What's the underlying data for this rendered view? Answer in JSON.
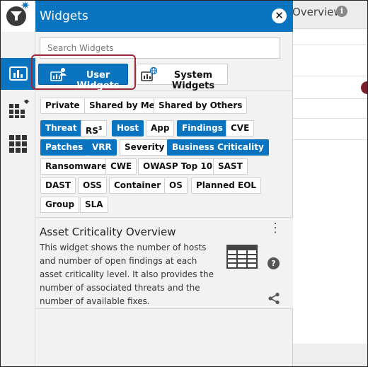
{
  "background": {
    "title_fragment": "Overview",
    "info_icon": "info-icon"
  },
  "rail": {
    "items": [
      {
        "icon": "bar-chart-icon",
        "active": true
      },
      {
        "icon": "grid-add-icon",
        "active": false
      },
      {
        "icon": "grid-icon",
        "active": false
      }
    ]
  },
  "panel": {
    "title": "Widgets",
    "close_icon": "close-icon",
    "search_placeholder": "Search Widgets",
    "buttons": {
      "user": "User Widgets",
      "system": "System Widgets"
    },
    "filter_rows": [
      [
        {
          "label": "Private",
          "selected": false
        },
        {
          "label": "Shared by Me",
          "selected": false
        },
        {
          "label": "Shared by Others",
          "selected": false
        }
      ],
      [
        {
          "label": "Threat",
          "selected": true
        },
        {
          "label": "RS",
          "sup": "3",
          "selected": false
        },
        {
          "label": "Host",
          "selected": true
        },
        {
          "label": "App",
          "selected": false
        },
        {
          "label": "Findings",
          "selected": true
        },
        {
          "label": "CVE",
          "selected": false
        }
      ],
      [
        {
          "label": "Patches",
          "selected": true
        },
        {
          "label": "VRR",
          "selected": true
        },
        {
          "label": "Severity",
          "selected": false
        },
        {
          "label": "Business Criticality",
          "selected": true
        }
      ],
      [
        {
          "label": "Ransomware",
          "selected": false
        },
        {
          "label": "CWE",
          "selected": false
        },
        {
          "label": "OWASP Top 10",
          "selected": false
        },
        {
          "label": "SAST",
          "selected": false
        }
      ],
      [
        {
          "label": "DAST",
          "selected": false
        },
        {
          "label": "OSS",
          "selected": false
        },
        {
          "label": "Container",
          "selected": false
        },
        {
          "label": "OS",
          "selected": false
        },
        {
          "label": "Planned EOL",
          "selected": false
        }
      ],
      [
        {
          "label": "Group",
          "selected": false
        },
        {
          "label": "SLA",
          "selected": false
        }
      ]
    ],
    "widget_card": {
      "title": "Asset Criticality Overview",
      "description": "This widget shows the number of hosts and number of open findings at each asset criticality level. It also provides the number of associated threats and the number of available fixes.",
      "menu_icon": "more-vertical-icon",
      "preview_icon": "table-icon",
      "help_icon": "help-icon",
      "share_icon": "share-icon"
    }
  },
  "colors": {
    "primary": "#0b74c0",
    "highlight": "#9b2836",
    "panel_bg": "#f2f2f2"
  }
}
